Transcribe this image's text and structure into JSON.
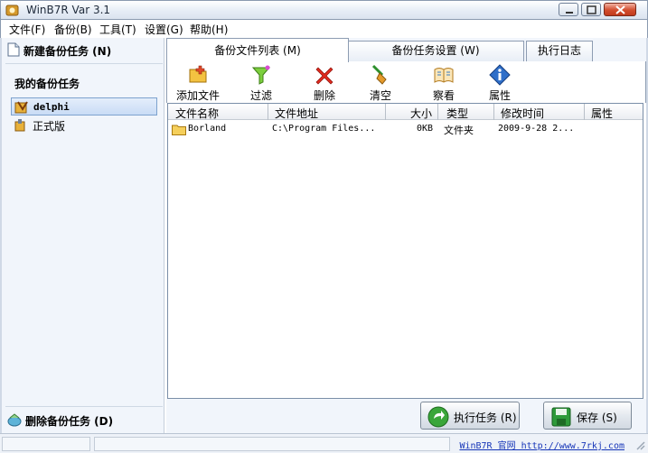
{
  "window": {
    "title": "WinB7R Var 3.1",
    "accent": "#d24d2e"
  },
  "menu": [
    "文件(F)",
    "备份(B)",
    "工具(T)",
    "设置(G)",
    "帮助(H)"
  ],
  "left": {
    "new_task": "新建备份任务 (N)",
    "heading": "我的备份任务",
    "tasks": [
      {
        "label": "delphi",
        "selected": true
      },
      {
        "label": "正式版",
        "selected": false
      }
    ],
    "delete_task": "删除备份任务 (D)"
  },
  "tabs": [
    {
      "label": "备份文件列表 (M)",
      "active": true
    },
    {
      "label": "备份任务设置 (W)",
      "active": false
    },
    {
      "label": "执行日志",
      "active": false
    }
  ],
  "toolbar": {
    "add": "添加文件",
    "filter": "过滤",
    "delete": "删除",
    "clear": "清空",
    "view": "察看",
    "properties": "属性"
  },
  "table": {
    "columns": [
      "文件名称",
      "文件地址",
      "大小",
      "类型",
      "修改时间",
      "属性"
    ],
    "rows": [
      {
        "name": "Borland",
        "path": "C:\\Program Files...",
        "size": "0KB",
        "type": "文件夹",
        "modified": "2009-9-28 2...",
        "attr": ""
      }
    ]
  },
  "actions": {
    "run": "执行任务 (R)",
    "save": "保存 (S)"
  },
  "status": {
    "link": "WinB7R 官网 http://www.7rkj.com"
  }
}
